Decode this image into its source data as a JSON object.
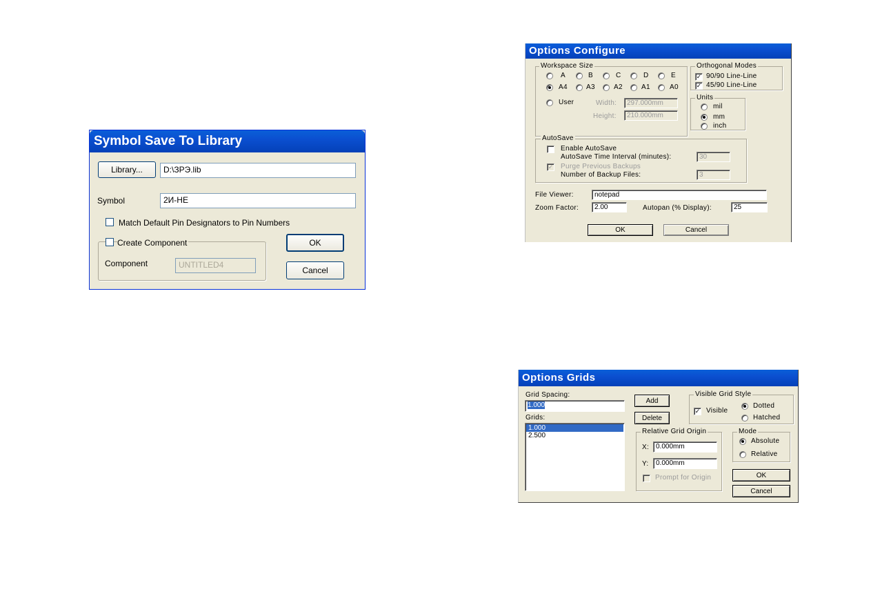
{
  "symbol_save": {
    "title": "Symbol Save To Library",
    "library_button": "Library...",
    "library_path": "D:\\ЗРЭ.lib",
    "symbol_label": "Symbol",
    "symbol_value": "2И-НЕ",
    "match_pin_label": "Match Default Pin Designators to Pin Numbers",
    "match_pin_checked": false,
    "create_component_label": "Create Component",
    "create_component_checked": false,
    "component_label": "Component",
    "component_value": "UNTITLED4",
    "ok_label": "OK",
    "cancel_label": "Cancel"
  },
  "options_configure": {
    "title": "Options Configure",
    "workspace_size": {
      "label": "Workspace Size",
      "row1": [
        "A",
        "B",
        "C",
        "D",
        "E"
      ],
      "row2": [
        "A4",
        "A3",
        "A2",
        "A1",
        "A0"
      ],
      "selected": "A4",
      "user_label": "User",
      "width_label": "Width:",
      "width_value": "297.000mm",
      "height_label": "Height:",
      "height_value": "210.000mm"
    },
    "orthogonal_modes": {
      "label": "Orthogonal Modes",
      "items": [
        {
          "label": "90/90  Line-Line",
          "checked": true
        },
        {
          "label": "45/90  Line-Line",
          "checked": true
        }
      ]
    },
    "units": {
      "label": "Units",
      "options": [
        "mil",
        "mm",
        "inch"
      ],
      "selected": "mm"
    },
    "autosave": {
      "label": "AutoSave",
      "enable_label": "Enable AutoSave",
      "interval_label": "AutoSave Time Interval (minutes):",
      "interval_value": "30",
      "purge_label": "Purge Previous Backups",
      "backup_files_label": "Number of Backup Files:",
      "backup_files_value": "3"
    },
    "file_viewer_label": "File Viewer:",
    "file_viewer_value": "notepad",
    "zoom_label": "Zoom Factor:",
    "zoom_value": "2.00",
    "autopan_label": "Autopan (% Display):",
    "autopan_value": "25",
    "ok_label": "OK",
    "cancel_label": "Cancel"
  },
  "options_grids": {
    "title": "Options Grids",
    "grid_spacing_label": "Grid Spacing:",
    "grid_spacing_value": "1.000",
    "grids_label": "Grids:",
    "grids": [
      "1.000",
      "2.500"
    ],
    "selected_grid": "1.000",
    "add_label": "Add",
    "delete_label": "Delete",
    "visible_grid_style": {
      "label": "Visible Grid Style",
      "visible_label": "Visible",
      "visible_checked": true,
      "options": [
        "Dotted",
        "Hatched"
      ],
      "selected": "Dotted"
    },
    "relative_origin": {
      "label": "Relative Grid Origin",
      "x_label": "X:",
      "x_value": "0.000mm",
      "y_label": "Y:",
      "y_value": "0.000mm",
      "prompt_label": "Prompt for Origin"
    },
    "mode": {
      "label": "Mode",
      "options": [
        "Absolute",
        "Relative"
      ],
      "selected": "Absolute"
    },
    "ok_label": "OK",
    "cancel_label": "Cancel"
  }
}
